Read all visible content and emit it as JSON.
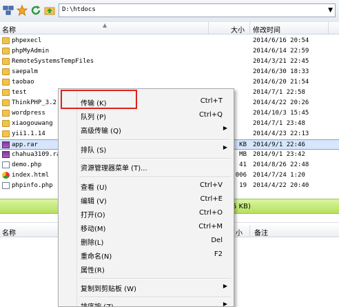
{
  "toolbar": {
    "path": "D:\\htdocs",
    "icons": [
      "network-sites-icon",
      "favorite-star-icon",
      "refresh-icon",
      "folder-up-icon"
    ]
  },
  "file_header": {
    "name": "名称",
    "size": "大小",
    "modified": "修改时间"
  },
  "files": [
    {
      "name": "phpexecl",
      "size": "",
      "modified": "2014/6/16 20:54",
      "type": "folder"
    },
    {
      "name": "phpMyAdmin",
      "size": "",
      "modified": "2014/6/14 22:59",
      "type": "folder"
    },
    {
      "name": "RemoteSystemsTempFiles",
      "size": "",
      "modified": "2014/3/21 22:45",
      "type": "folder"
    },
    {
      "name": "saepalm",
      "size": "",
      "modified": "2014/6/30 18:33",
      "type": "folder"
    },
    {
      "name": "taobao",
      "size": "",
      "modified": "2014/6/20 21:54",
      "type": "folder"
    },
    {
      "name": "test",
      "size": "",
      "modified": "2014/7/1 22:58",
      "type": "folder"
    },
    {
      "name": "ThinkPHP_3.2.",
      "size": "",
      "modified": "2014/4/22 20:26",
      "type": "folder"
    },
    {
      "name": "wordpress",
      "size": "",
      "modified": "2014/10/3 15:45",
      "type": "folder"
    },
    {
      "name": "xiaogouwang",
      "size": "",
      "modified": "2014/7/1 23:48",
      "type": "folder"
    },
    {
      "name": "yii1.1.14",
      "size": "",
      "modified": "2014/4/23 22:13",
      "type": "folder"
    },
    {
      "name": "app.rar",
      "size": "KB",
      "modified": "2014/9/1 22:46",
      "type": "rar"
    },
    {
      "name": "chahua3109.ra",
      "size": "MB",
      "modified": "2014/9/1 23:42",
      "type": "rar"
    },
    {
      "name": "demo.php",
      "size": "41",
      "modified": "2014/8/26 22:48",
      "type": "php"
    },
    {
      "name": "index.html",
      "size": "006",
      "modified": "2014/7/24 1:20",
      "type": "chrome"
    },
    {
      "name": "phpinfo.php",
      "size": "19",
      "modified": "2014/4/22 20:40",
      "type": "php"
    }
  ],
  "status_bar": {
    "text": "5 KB)"
  },
  "queue_header": {
    "name": "名称",
    "size": "小",
    "remark": "备注"
  },
  "context_menu": {
    "items": [
      {
        "label": "传输 (K)",
        "shortcut": "Ctrl+T",
        "submenu": false
      },
      {
        "label": "队列 (P)",
        "shortcut": "Ctrl+Q",
        "submenu": false
      },
      {
        "label": "高级传输 (Q)",
        "shortcut": "",
        "submenu": true
      },
      {
        "label": "排队 (S)",
        "shortcut": "",
        "submenu": true
      },
      {
        "label": "资源管理器菜单 (T)...",
        "shortcut": "",
        "submenu": false
      },
      {
        "label": "查看 (U)",
        "shortcut": "Ctrl+V",
        "submenu": false
      },
      {
        "label": "编辑 (V)",
        "shortcut": "Ctrl+E",
        "submenu": false
      },
      {
        "label": "打开(O)",
        "shortcut": "Ctrl+O",
        "submenu": false
      },
      {
        "label": "移动(M)",
        "shortcut": "Ctrl+M",
        "submenu": false
      },
      {
        "label": "删除(L)",
        "shortcut": "Del",
        "submenu": false
      },
      {
        "label": "重命名(N)",
        "shortcut": "F2",
        "submenu": false
      },
      {
        "label": "属性(R)",
        "shortcut": "",
        "submenu": false
      },
      {
        "label": "复制到剪贴板 (W)",
        "shortcut": "",
        "submenu": true
      },
      {
        "label": "排序按 (Z)",
        "shortcut": "",
        "submenu": true
      }
    ]
  },
  "colors": {
    "highlight": "#e0201a",
    "progress": "#b6e05d",
    "selected_row": "#d7e6fb"
  }
}
